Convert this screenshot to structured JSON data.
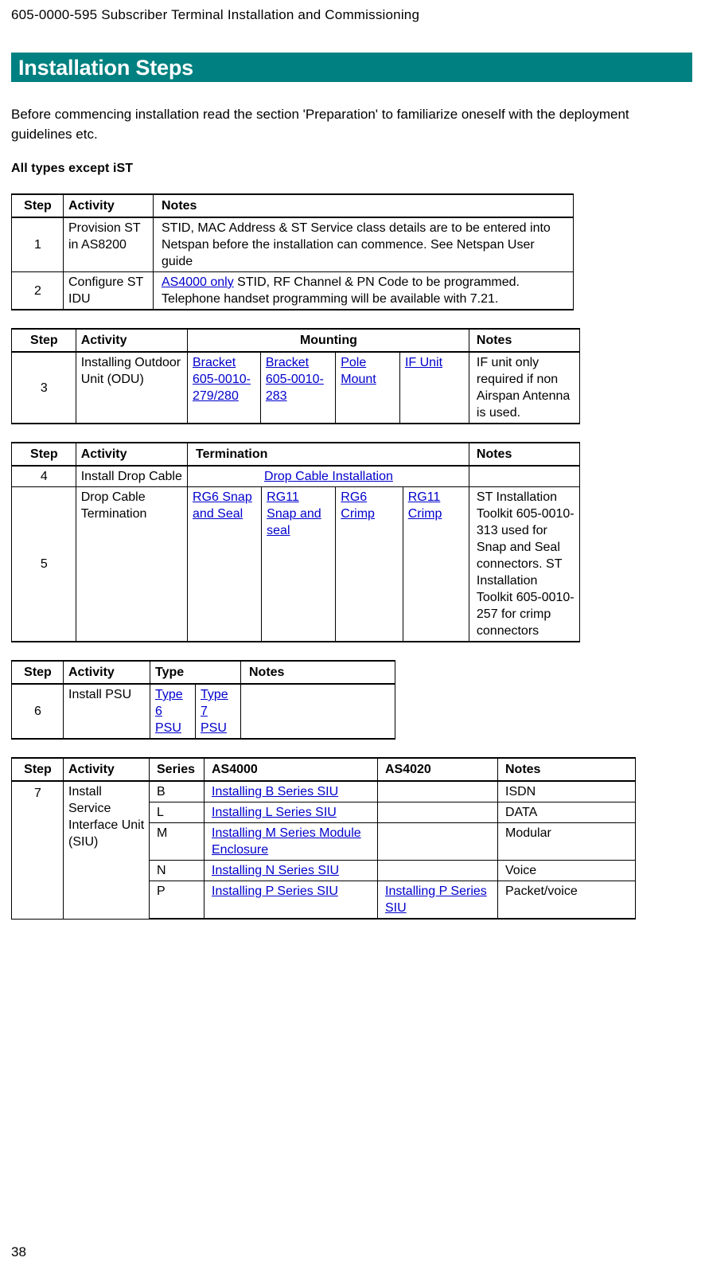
{
  "document": {
    "running_header": "605-0000-595 Subscriber Terminal Installation and Commissioning",
    "page_number": "38"
  },
  "section": {
    "title": "Installation Steps",
    "title_bar_color": "#008080",
    "intro": "Before commencing installation read the section 'Preparation' to familiarize oneself with the deployment guidelines etc.",
    "subheading": "All types except iST"
  },
  "link_color": "#0000CC",
  "tables": {
    "table1": {
      "headers": [
        "Step",
        "Activity",
        "Notes"
      ],
      "rows": [
        {
          "step": "1",
          "activity": "Provision ST in AS8200",
          "notes_plain": "STID, MAC Address & ST Service class details are to be entered into Netspan before the installation can commence. See Netspan User guide"
        },
        {
          "step": "2",
          "activity": "Configure ST IDU",
          "notes_link": "AS4000 only",
          "notes_rest": " STID, RF Channel & PN Code to be programmed.",
          "notes_line2": "Telephone handset programming will be available with 7.21."
        }
      ]
    },
    "table2": {
      "headers": [
        "Step",
        "Activity",
        "Mounting",
        "Notes"
      ],
      "rows": [
        {
          "step": "3",
          "activity": "Installing Outdoor Unit (ODU)",
          "mounting_links": [
            "Bracket 605-0010-279/280",
            " Bracket 605-0010-283",
            "Pole Mount",
            "IF Unit"
          ],
          "notes": "IF unit only required if non Airspan Antenna is used."
        }
      ]
    },
    "table3": {
      "headers": [
        "Step",
        "Activity",
        "Termination",
        "Notes"
      ],
      "rows": [
        {
          "step": "4",
          "activity": "Install Drop Cable",
          "termination_link": "Drop Cable Installation",
          "notes": ""
        },
        {
          "step": "5",
          "activity": "Drop Cable Termination",
          "termination_links": [
            "RG6 Snap and Seal",
            "RG11 Snap and seal",
            "RG6 Crimp",
            "RG11 Crimp"
          ],
          "notes": "ST Installation Toolkit 605-0010-313  used for Snap and Seal connectors. ST Installation Toolkit 605-0010-257 for crimp connectors"
        }
      ]
    },
    "table4": {
      "headers": [
        "Step",
        "Activity",
        "Type",
        "Notes"
      ],
      "rows": [
        {
          "step": "6",
          "activity": "Install PSU",
          "type_links": [
            "Type 6 PSU",
            "Type 7 PSU"
          ],
          "notes": ""
        }
      ]
    },
    "table5": {
      "headers": [
        "Step",
        "Activity",
        "Series",
        "AS4000",
        "AS4020",
        "Notes"
      ],
      "step": "7",
      "activity": "Install Service Interface Unit (SIU)",
      "rows": [
        {
          "series": "B",
          "as4000": "Installing B Series SIU",
          "as4020": "",
          "notes": " ISDN"
        },
        {
          "series": "L",
          "as4000": "Installing L Series SIU",
          "as4020": "",
          "notes": "DATA"
        },
        {
          "series": "M",
          "as4000": "Installing M Series Module Enclosure",
          "as4020": "",
          "notes": "Modular"
        },
        {
          "series": "N",
          "as4000": "Installing N Series SIU",
          "as4020": "",
          "notes": "Voice"
        },
        {
          "series": "P",
          "as4000": "Installing P Series SIU",
          "as4020": "Installing P Series SIU",
          "notes": "Packet/voice"
        }
      ]
    }
  }
}
